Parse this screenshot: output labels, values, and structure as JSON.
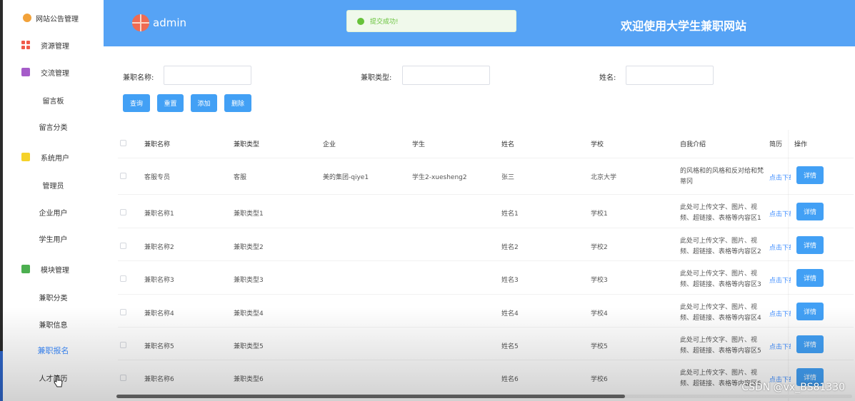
{
  "sidebar": {
    "items": [
      {
        "label": "网站公告管理",
        "icon": "gear-icon"
      },
      {
        "label": "资源管理",
        "icon": "grid-icon"
      },
      {
        "label": "交流管理",
        "icon": "box-icon"
      },
      {
        "label": "留言板",
        "sub": true
      },
      {
        "label": "留言分类",
        "sub": true
      },
      {
        "label": "系统用户",
        "icon": "hexagon-icon"
      },
      {
        "label": "管理员",
        "sub": true
      },
      {
        "label": "企业用户",
        "sub": true
      },
      {
        "label": "学生用户",
        "sub": true
      },
      {
        "label": "模块管理",
        "icon": "chat-icon"
      },
      {
        "label": "兼职分类",
        "sub": true
      },
      {
        "label": "兼职信息",
        "sub": true
      },
      {
        "label": "兼职报名",
        "sub": true,
        "active": true
      },
      {
        "label": "人才简历",
        "sub": true
      }
    ]
  },
  "header": {
    "user": "admin",
    "toast": "提交成功!",
    "title": "欢迎使用大学生兼职网站",
    "color": "#56a3f5"
  },
  "search": {
    "name_label": "兼职名称:",
    "type_label": "兼职类型:",
    "person_label": "姓名:",
    "name_value": "",
    "type_value": "",
    "person_value": ""
  },
  "buttons": {
    "query": "查询",
    "reset": "重置",
    "add": "添加",
    "delete": "删除"
  },
  "table": {
    "headers": [
      "兼职名称",
      "兼职类型",
      "企业",
      "学生",
      "姓名",
      "学校",
      "自我介绍",
      "简历",
      "操作"
    ],
    "rows": [
      {
        "name": "客服专员",
        "type": "客服",
        "company": "美的集团-qiye1",
        "student": "学生2-xuesheng2",
        "person": "张三",
        "school": "北京大学",
        "intro": "的风格和的风格和反对给和梵蒂冈",
        "resume": "点击下载",
        "action": "详情"
      },
      {
        "name": "兼职名称1",
        "type": "兼职类型1",
        "company": "",
        "student": "",
        "person": "姓名1",
        "school": "学校1",
        "intro": "此处可上传文字、图片、视频、超链接、表格等内容区1",
        "resume": "点击下载",
        "action": "详情"
      },
      {
        "name": "兼职名称2",
        "type": "兼职类型2",
        "company": "",
        "student": "",
        "person": "姓名2",
        "school": "学校2",
        "intro": "此处可上传文字、图片、视频、超链接、表格等内容区2",
        "resume": "点击下载",
        "action": "详情"
      },
      {
        "name": "兼职名称3",
        "type": "兼职类型3",
        "company": "",
        "student": "",
        "person": "姓名3",
        "school": "学校3",
        "intro": "此处可上传文字、图片、视频、超链接、表格等内容区3",
        "resume": "点击下载",
        "action": "详情"
      },
      {
        "name": "兼职名称4",
        "type": "兼职类型4",
        "company": "",
        "student": "",
        "person": "姓名4",
        "school": "学校4",
        "intro": "此处可上传文字、图片、视频、超链接、表格等内容区4",
        "resume": "点击下载",
        "action": "详情"
      },
      {
        "name": "兼职名称5",
        "type": "兼职类型5",
        "company": "",
        "student": "",
        "person": "姓名5",
        "school": "学校5",
        "intro": "此处可上传文字、图片、视频、超链接、表格等内容区5",
        "resume": "点击下载",
        "action": "详情"
      },
      {
        "name": "兼职名称6",
        "type": "兼职类型6",
        "company": "",
        "student": "",
        "person": "姓名6",
        "school": "学校6",
        "intro": "此处可上传文字、图片、视频、超链接、表格等内容区6",
        "resume": "点击下载",
        "action": "详情"
      }
    ]
  },
  "watermark": "CSDN @vx_BS81330"
}
